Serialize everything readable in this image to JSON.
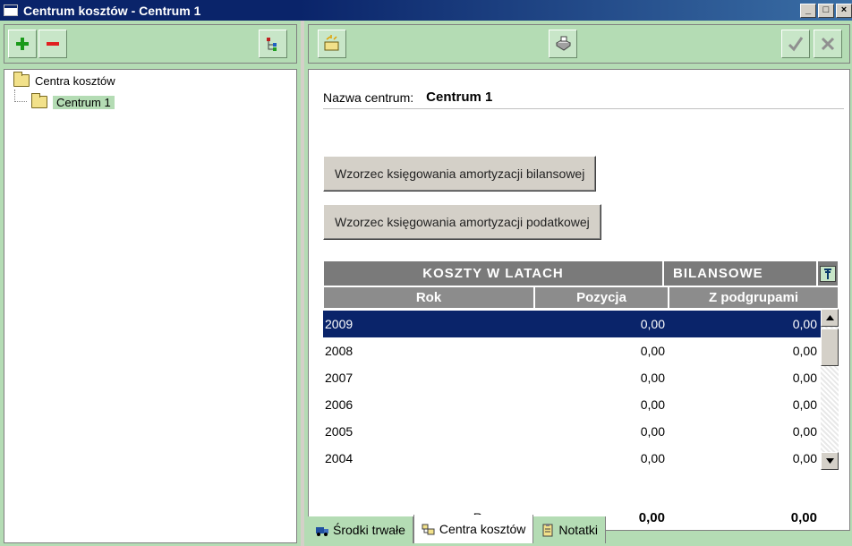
{
  "window": {
    "title": "Centrum kosztów - Centrum 1",
    "controls": {
      "minimize": "_",
      "maximize": "□",
      "close": "×"
    }
  },
  "left_toolbar": {
    "add_icon": "plus-icon",
    "remove_icon": "minus-icon",
    "tree_icon": "tree-view-icon"
  },
  "tree": {
    "root_label": "Centra kosztów",
    "child_label": "Centrum 1"
  },
  "right_toolbar": {
    "new_icon": "new-document-icon",
    "print_icon": "printer-icon",
    "confirm_icon": "check-icon",
    "cancel_icon": "close-icon"
  },
  "form": {
    "name_label": "Nazwa centrum:",
    "name_value": "Centrum 1",
    "btn_balance": "Wzorzec księgowania amortyzacji bilansowej",
    "btn_tax": "Wzorzec księgowania amortyzacji podatkowej"
  },
  "grid": {
    "header_title": "KOSZTY W LATACH",
    "header_mode": "BILANSOWE",
    "columns": [
      "Rok",
      "Pozycja",
      "Z podgrupami"
    ],
    "rows": [
      {
        "rok": "2009",
        "pozycja": "0,00",
        "z_podgrupami": "0,00",
        "selected": true
      },
      {
        "rok": "2008",
        "pozycja": "0,00",
        "z_podgrupami": "0,00",
        "selected": false
      },
      {
        "rok": "2007",
        "pozycja": "0,00",
        "z_podgrupami": "0,00",
        "selected": false
      },
      {
        "rok": "2006",
        "pozycja": "0,00",
        "z_podgrupami": "0,00",
        "selected": false
      },
      {
        "rok": "2005",
        "pozycja": "0,00",
        "z_podgrupami": "0,00",
        "selected": false
      },
      {
        "rok": "2004",
        "pozycja": "0,00",
        "z_podgrupami": "0,00",
        "selected": false
      }
    ],
    "total_label": "Razem:",
    "total_pozycja": "0,00",
    "total_z_podgrupami": "0,00"
  },
  "tabs": [
    {
      "label": "Środki trwałe",
      "icon": "truck-icon",
      "active": false
    },
    {
      "label": "Centra kosztów",
      "icon": "cost-centers-icon",
      "active": true
    },
    {
      "label": "Notatki",
      "icon": "notes-icon",
      "active": false
    }
  ],
  "colors": {
    "accent_green": "#b4dcb4",
    "title_blue": "#0a246a",
    "grid_header": "#7a7a7a"
  }
}
